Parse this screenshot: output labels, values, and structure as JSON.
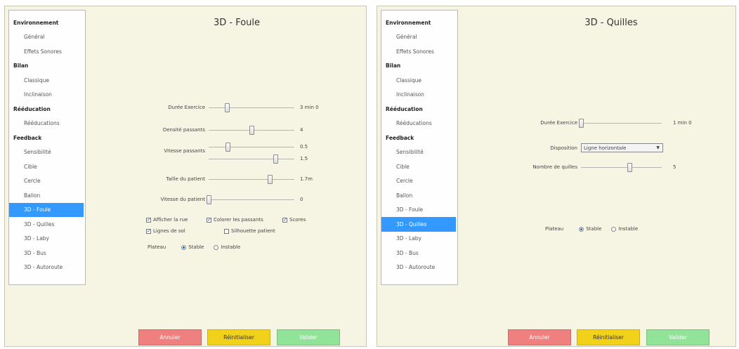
{
  "sidebar": {
    "groups": [
      {
        "label": "Environnement",
        "items": [
          "Général",
          "Effets Sonores"
        ]
      },
      {
        "label": "Bilan",
        "items": [
          "Classique",
          "Inclinaison"
        ]
      },
      {
        "label": "Rééducation",
        "items": [
          "Rééducations"
        ]
      },
      {
        "label": "Feedback",
        "items": [
          "Sensibilité",
          "Cible",
          "Cercle",
          "Ballon",
          "3D - Foule",
          "3D - Quilles",
          "3D - Laby",
          "3D - Bus",
          "3D - Autoroute"
        ]
      }
    ]
  },
  "left": {
    "title": "3D - Foule",
    "selected": "3D - Foule",
    "sliders": {
      "duree": {
        "label": "Durée Exercice",
        "value": "3 min 0",
        "level": 0.21
      },
      "densite": {
        "label": "Densité passants",
        "value": "4",
        "level": 0.5
      },
      "vitesse": {
        "label": "Vitesse passants",
        "value_min": "0.5",
        "value_max": "1.5",
        "level_min": 0.22,
        "level_max": 0.78
      },
      "taille": {
        "label": "Taille du patient",
        "value": "1.7m",
        "level": 0.71
      },
      "vitesse_patient": {
        "label": "Vitesse du patient",
        "value": "0",
        "level": 0.0
      }
    },
    "checkboxes": {
      "afficher_rue": {
        "label": "Afficher la rue",
        "checked": true
      },
      "colorer": {
        "label": "Colorer les passants",
        "checked": true
      },
      "scores": {
        "label": "Scores",
        "checked": true
      },
      "lignes_sol": {
        "label": "Lignes de sol",
        "checked": true
      },
      "silhouette": {
        "label": "Silhouette patient",
        "checked": false
      }
    },
    "plateau": {
      "label": "Plateau",
      "stable": "Stable",
      "instable": "Instable",
      "selected": "Stable"
    }
  },
  "right": {
    "title": "3D - Quilles",
    "selected": "3D - Quilles",
    "duree": {
      "label": "Durée Exercice",
      "value": "1 min 0",
      "level": 0.0
    },
    "disposition": {
      "label": "Disposition",
      "value": "Ligne horizontale"
    },
    "quilles": {
      "label": "Nombre de quilles",
      "value": "5",
      "level": 0.6
    },
    "plateau": {
      "label": "Plateau",
      "stable": "Stable",
      "instable": "Instable",
      "selected": "Stable"
    }
  },
  "buttons": {
    "annuler": "Annuler",
    "reinit": "Réinitialiser",
    "valider": "Valider"
  },
  "icons": {
    "dropdown": "chevron-down-icon",
    "check": "check-icon"
  }
}
